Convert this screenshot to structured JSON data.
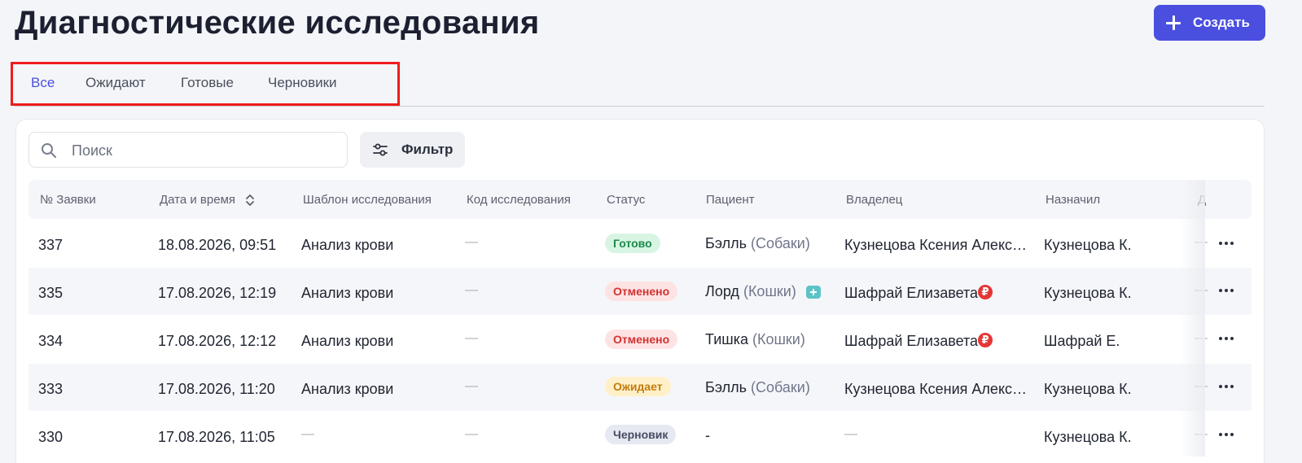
{
  "page": {
    "title": "Диагностические исследования"
  },
  "header": {
    "create_label": "Создать"
  },
  "tabs": [
    {
      "label": "Все",
      "active": true
    },
    {
      "label": "Ожидают",
      "active": false
    },
    {
      "label": "Готовые",
      "active": false
    },
    {
      "label": "Черновики",
      "active": false
    }
  ],
  "search": {
    "placeholder": "Поиск",
    "value": ""
  },
  "filter": {
    "label": "Фильтр"
  },
  "columns": [
    "№ Заявки",
    "Дата и время",
    "Шаблон исследования",
    "Код исследования",
    "Статус",
    "Пациент",
    "Владелец",
    "Назначил",
    "Д"
  ],
  "rows": [
    {
      "id": "337",
      "datetime": "18.08.2026, 09:51",
      "template": "Анализ крови",
      "code": "—",
      "status": "Готово",
      "patient": "Бэлль",
      "species": "(Собаки)",
      "owner": "Кузнецова Ксения Алекс…",
      "assigned": "Кузнецова К.",
      "extra": "—"
    },
    {
      "id": "335",
      "datetime": "17.08.2026, 12:19",
      "template": "Анализ крови",
      "code": "—",
      "status": "Отменено",
      "patient": "Лорд",
      "species": "(Кошки)",
      "owner": "Шафрай Елизавета",
      "assigned": "Кузнецова К.",
      "extra": "—"
    },
    {
      "id": "334",
      "datetime": "17.08.2026, 12:12",
      "template": "Анализ крови",
      "code": "—",
      "status": "Отменено",
      "patient": "Тишка",
      "species": "(Кошки)",
      "owner": "Шафрай Елизавета",
      "assigned": "Шафрай Е.",
      "extra": "—"
    },
    {
      "id": "333",
      "datetime": "17.08.2026, 11:20",
      "template": "Анализ крови",
      "code": "—",
      "status": "Ожидает",
      "patient": "Бэлль",
      "species": "(Собаки)",
      "owner": "Кузнецова Ксения Алекс…",
      "assigned": "Кузнецова К.",
      "extra": "—"
    },
    {
      "id": "330",
      "datetime": "17.08.2026, 11:05",
      "template": "—",
      "code": "—",
      "status": "Черновик",
      "patient": "-",
      "species": "",
      "owner": "—",
      "assigned": "Кузнецова К.",
      "extra": "—"
    }
  ],
  "icons": {
    "ruble": "₽"
  },
  "colors": {
    "accent": "#4a4fe0",
    "ready": "#1b8a4a",
    "cancel": "#d23333",
    "wait": "#c27c10",
    "draft": "#464c63"
  }
}
